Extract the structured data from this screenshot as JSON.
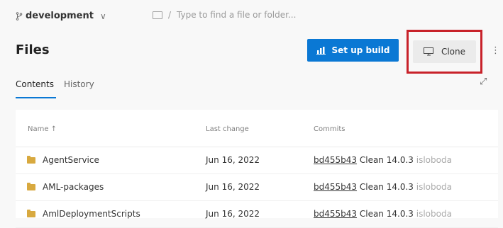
{
  "header": {
    "branch": "development",
    "path_separator": "/",
    "path_placeholder": "Type to find a file or folder...",
    "title": "Files"
  },
  "toolbar": {
    "setup_build_label": "Set up build",
    "clone_label": "Clone"
  },
  "tabs": [
    {
      "label": "Contents",
      "active": true
    },
    {
      "label": "History",
      "active": false
    }
  ],
  "table": {
    "columns": [
      "Name ↑",
      "Last change",
      "Commits"
    ],
    "rows": [
      {
        "name": "AgentService",
        "last_change": "Jun 16, 2022",
        "commit_hash": "bd455b43",
        "commit_msg": "Clean 14.0.3",
        "author": "isloboda"
      },
      {
        "name": "AML-packages",
        "last_change": "Jun 16, 2022",
        "commit_hash": "bd455b43",
        "commit_msg": "Clean 14.0.3",
        "author": "isloboda"
      },
      {
        "name": "AmlDeploymentScripts",
        "last_change": "Jun 16, 2022",
        "commit_hash": "bd455b43",
        "commit_msg": "Clean 14.0.3",
        "author": "isloboda"
      }
    ]
  },
  "colors": {
    "accent": "#0a78d4",
    "highlight": "#c8222a",
    "folder": "#d8a93f"
  },
  "icons": [
    "branch-icon",
    "chevron-down-icon",
    "folder-icon",
    "build-icon",
    "clone-icon",
    "more-icon",
    "expand-icon"
  ]
}
